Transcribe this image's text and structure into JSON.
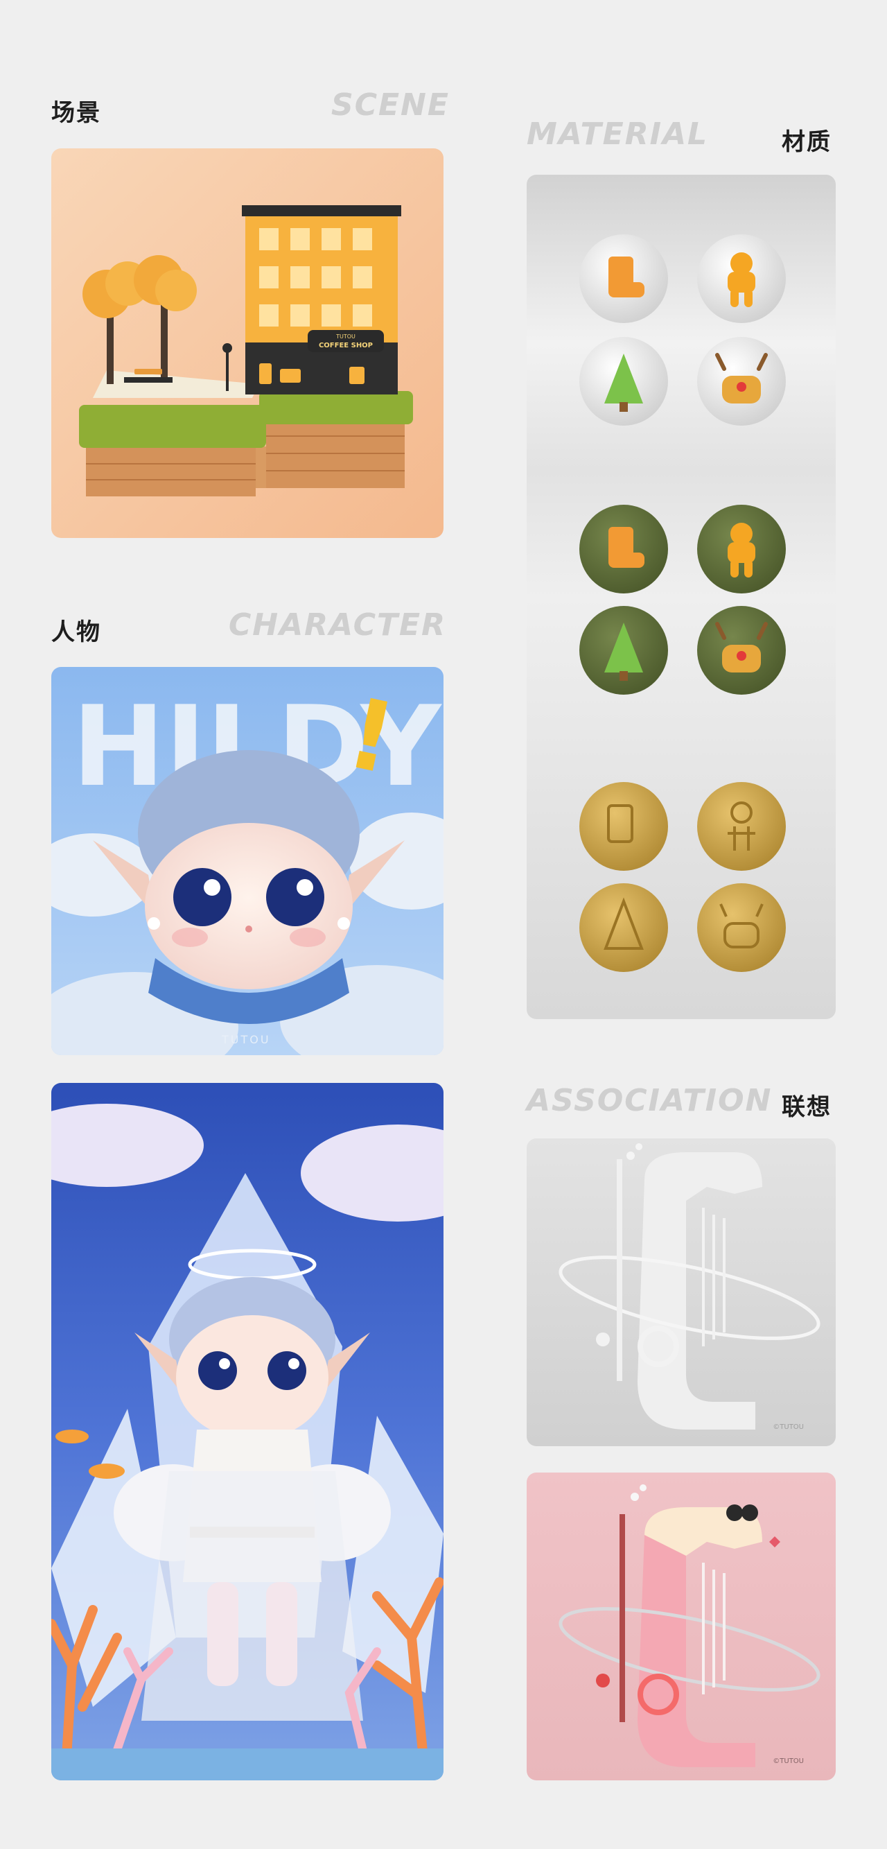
{
  "sections": {
    "scene": {
      "cn": "场景",
      "en": "SCENE"
    },
    "material": {
      "cn": "材质",
      "en": "MATERIAL"
    },
    "character": {
      "cn": "人物",
      "en": "CHARACTER"
    },
    "association": {
      "cn": "联想",
      "en": "ASSOCIATION"
    }
  },
  "scene_card": {
    "sign_top": "TUTOU",
    "sign_main": "COFFEE SHOP"
  },
  "hildy_card": {
    "headline": "HILDY",
    "exclaim": "!",
    "watermark": "TUTOU"
  },
  "association_cards": {
    "watermark_gray": "©TUTOU",
    "watermark_pink": "©TUTOU"
  },
  "colors": {
    "background": "#efefef",
    "scene_bg": "#f6c7a0",
    "material_bg": "#dcdcdc",
    "green_badge": "#5e6e3a",
    "gold_badge": "#c9a24c",
    "hildy_bg": "#9cc3ef",
    "angel_bg": "#3b5fc9",
    "pink_bg": "#f2c9cc"
  }
}
